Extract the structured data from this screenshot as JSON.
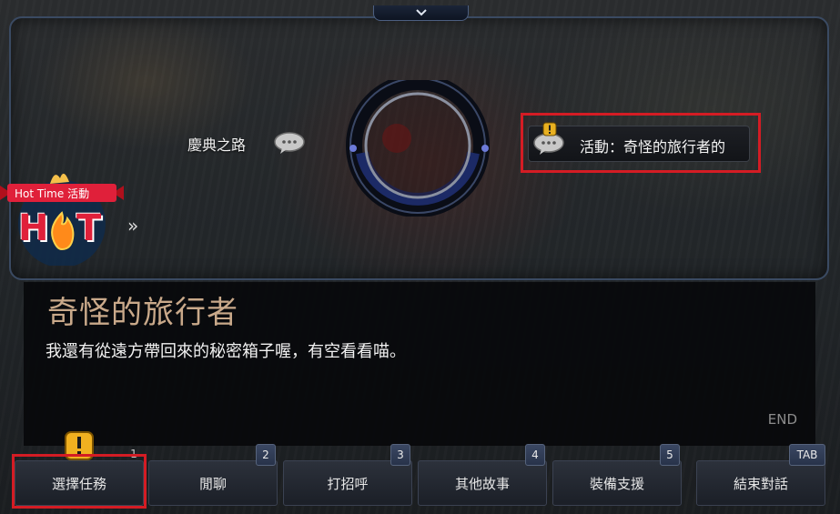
{
  "collapse_icon": "chevron-down-icon",
  "npc_menu": {
    "label": "慶典之路",
    "quest_option": "活動：奇怪的旅行者的"
  },
  "hot_badge": {
    "banner": "Hot Time 活動",
    "text_left": "H",
    "text_right": "T",
    "arrow": "»"
  },
  "dialog": {
    "npc_name": "奇怪的旅行者",
    "text": "我還有從遠方帶回來的秘密箱子喔，有空看看喵。",
    "end_label": "END"
  },
  "action_buttons": [
    {
      "label": "選擇任務",
      "key": "1"
    },
    {
      "label": "閒聊",
      "key": "2"
    },
    {
      "label": "打招呼",
      "key": "3"
    },
    {
      "label": "其他故事",
      "key": "4"
    },
    {
      "label": "裝備支援",
      "key": "5"
    },
    {
      "label": "結束對話",
      "key": "TAB"
    }
  ],
  "colors": {
    "highlight": "#d41c24",
    "npc_name": "#c9a98a",
    "hot_red": "#e0203a"
  }
}
